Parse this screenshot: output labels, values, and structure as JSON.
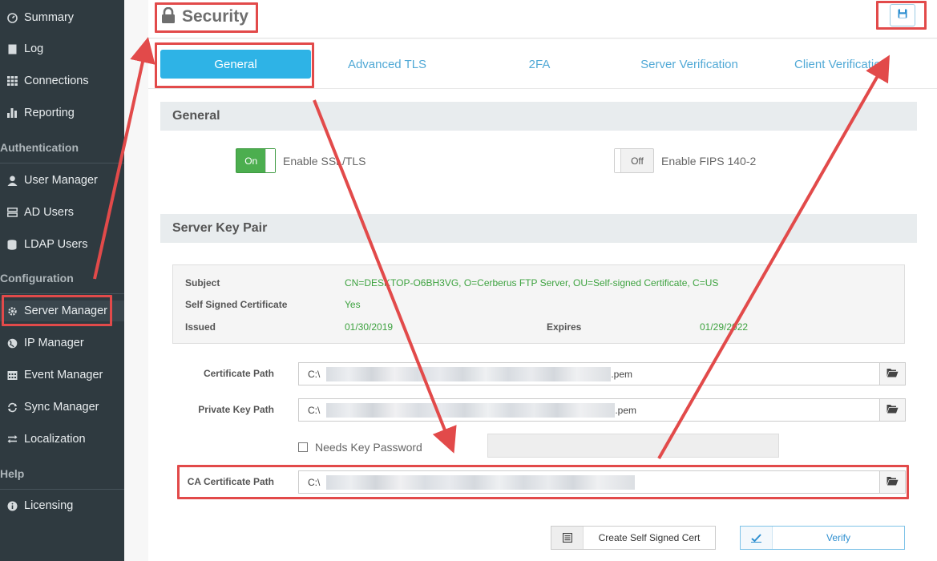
{
  "sidebar": {
    "items": [
      {
        "label": "Summary",
        "icon": "gauge-icon"
      },
      {
        "label": "Log",
        "icon": "file-icon"
      },
      {
        "label": "Connections",
        "icon": "grid-icon"
      },
      {
        "label": "Reporting",
        "icon": "bar-chart-icon"
      }
    ],
    "auth_heading": "Authentication",
    "auth_items": [
      {
        "label": "User Manager",
        "icon": "user-icon"
      },
      {
        "label": "AD Users",
        "icon": "server-icon"
      },
      {
        "label": "LDAP Users",
        "icon": "database-icon"
      }
    ],
    "config_heading": "Configuration",
    "config_items": [
      {
        "label": "Server Manager",
        "icon": "gear-icon"
      },
      {
        "label": "IP Manager",
        "icon": "globe-icon"
      },
      {
        "label": "Event Manager",
        "icon": "calendar-icon"
      },
      {
        "label": "Sync Manager",
        "icon": "sync-icon"
      },
      {
        "label": "Localization",
        "icon": "exchange-icon"
      }
    ],
    "help_heading": "Help",
    "help_items": [
      {
        "label": "Licensing",
        "icon": "info-icon"
      }
    ]
  },
  "header": {
    "title": "Security",
    "save_icon": "save-icon"
  },
  "tabs": [
    "General",
    "Advanced TLS",
    "2FA",
    "Server Verification",
    "Client Verification"
  ],
  "general": {
    "section_title": "General",
    "ssl": {
      "state": "On",
      "label": "Enable SSL/TLS"
    },
    "fips": {
      "state": "Off",
      "label": "Enable FIPS 140-2"
    }
  },
  "keypair": {
    "section_title": "Server Key Pair",
    "subject_label": "Subject",
    "subject_value": "CN=DESKTOP-O6BH3VG, O=Cerberus FTP Server, OU=Self-signed Certificate, C=US",
    "self_signed_label": "Self Signed Certificate",
    "self_signed_value": "Yes",
    "issued_label": "Issued",
    "issued_value": "01/30/2019",
    "expires_label": "Expires",
    "expires_value": "01/29/2022"
  },
  "paths": {
    "certificate_label": "Certificate Path",
    "certificate_prefix": "C:\\",
    "certificate_suffix": ".pem",
    "private_key_label": "Private Key Path",
    "private_key_prefix": "C:\\",
    "private_key_suffix": ".pem",
    "needs_password_label": "Needs Key Password",
    "ca_certificate_label": "CA Certificate Path",
    "ca_certificate_prefix": "C:\\"
  },
  "actions": {
    "create_cert_label": "Create Self Signed Cert",
    "verify_label": "Verify"
  },
  "colors": {
    "sidebar_bg": "#2f3a40",
    "accent_blue": "#2eb3e6",
    "toggle_green": "#4cae4f",
    "annotation_red": "#e24a4a",
    "value_green": "#3da23f"
  }
}
